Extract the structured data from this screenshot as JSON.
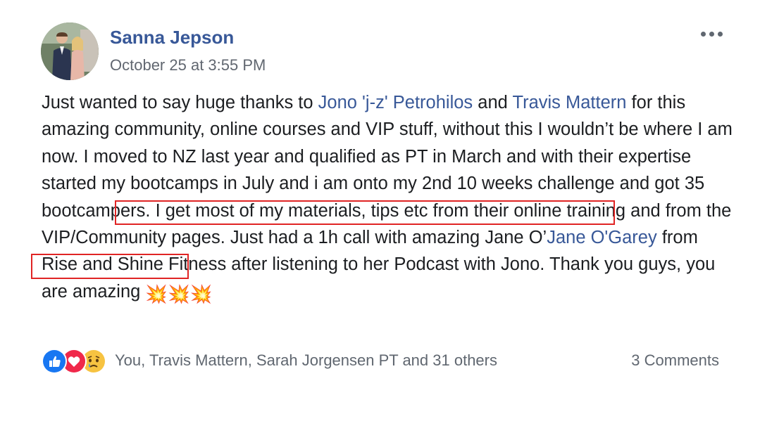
{
  "post": {
    "author_name": "Sanna Jepson",
    "timestamp": "October 25 at 3:55 PM",
    "more_icon": "more-options-icon",
    "body": {
      "text1": "Just wanted to say huge thanks to ",
      "link1": "Jono 'j-z' Petrohilos",
      "text2": " and ",
      "link2": "Travis Mattern",
      "text3": " for this amazing community, online courses and VIP stuff, without this I wouldn’t be where I am now. I moved to NZ last year and qualified as PT in March and with their expertise started my bootcamps in July and i am onto ",
      "highlight1": "my 2nd 10 weeks challenge and got 35 bootcampers.",
      "text4": " I get most of my materials, tips etc from their online training and from the ",
      "highlight2": "VIP/Community",
      "text5": " pages. Just had a 1h call with amazing Jane O’",
      "link3": "Jane O'Garey",
      "text6": " from Rise and Shine Fitness after listening to her Podcast with Jono. Thank you guys, you are amazing ",
      "emoji": "💥💥💥"
    },
    "highlight_color": "#e02424",
    "link_color": "#385898"
  },
  "footer": {
    "reactions": [
      "like-icon",
      "love-icon",
      "sad-icon"
    ],
    "reaction_names": "You, Travis Mattern, Sarah Jorgensen PT and 31 others",
    "comment_count": "3 Comments"
  }
}
